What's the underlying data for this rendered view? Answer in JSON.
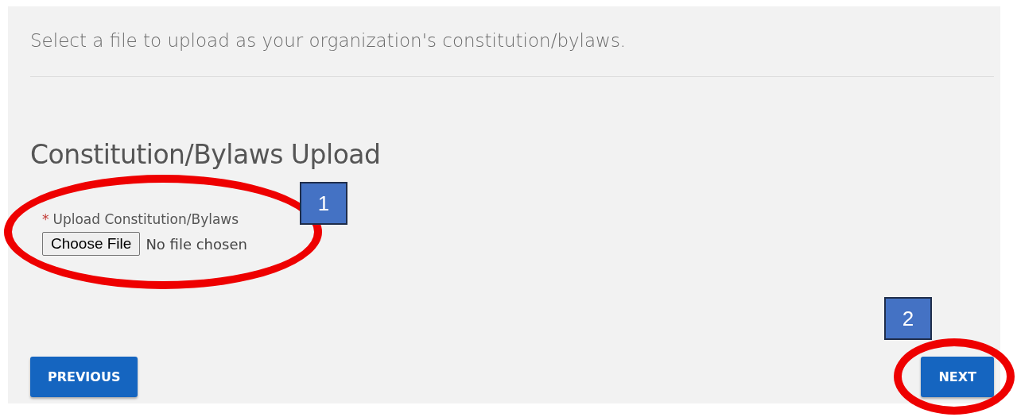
{
  "intro": "Select a file to upload as your organization's constitution/bylaws.",
  "section": {
    "title": "Constitution/Bylaws Upload",
    "field": {
      "required_mark": "*",
      "label": "Upload Constitution/Bylaws",
      "button": "Choose File",
      "status": "No file chosen"
    }
  },
  "buttons": [
    {
      "label": "PREVIOUS"
    },
    {
      "label": "NEXT"
    }
  ],
  "callouts": [
    {
      "number": "1"
    },
    {
      "number": "2"
    }
  ]
}
